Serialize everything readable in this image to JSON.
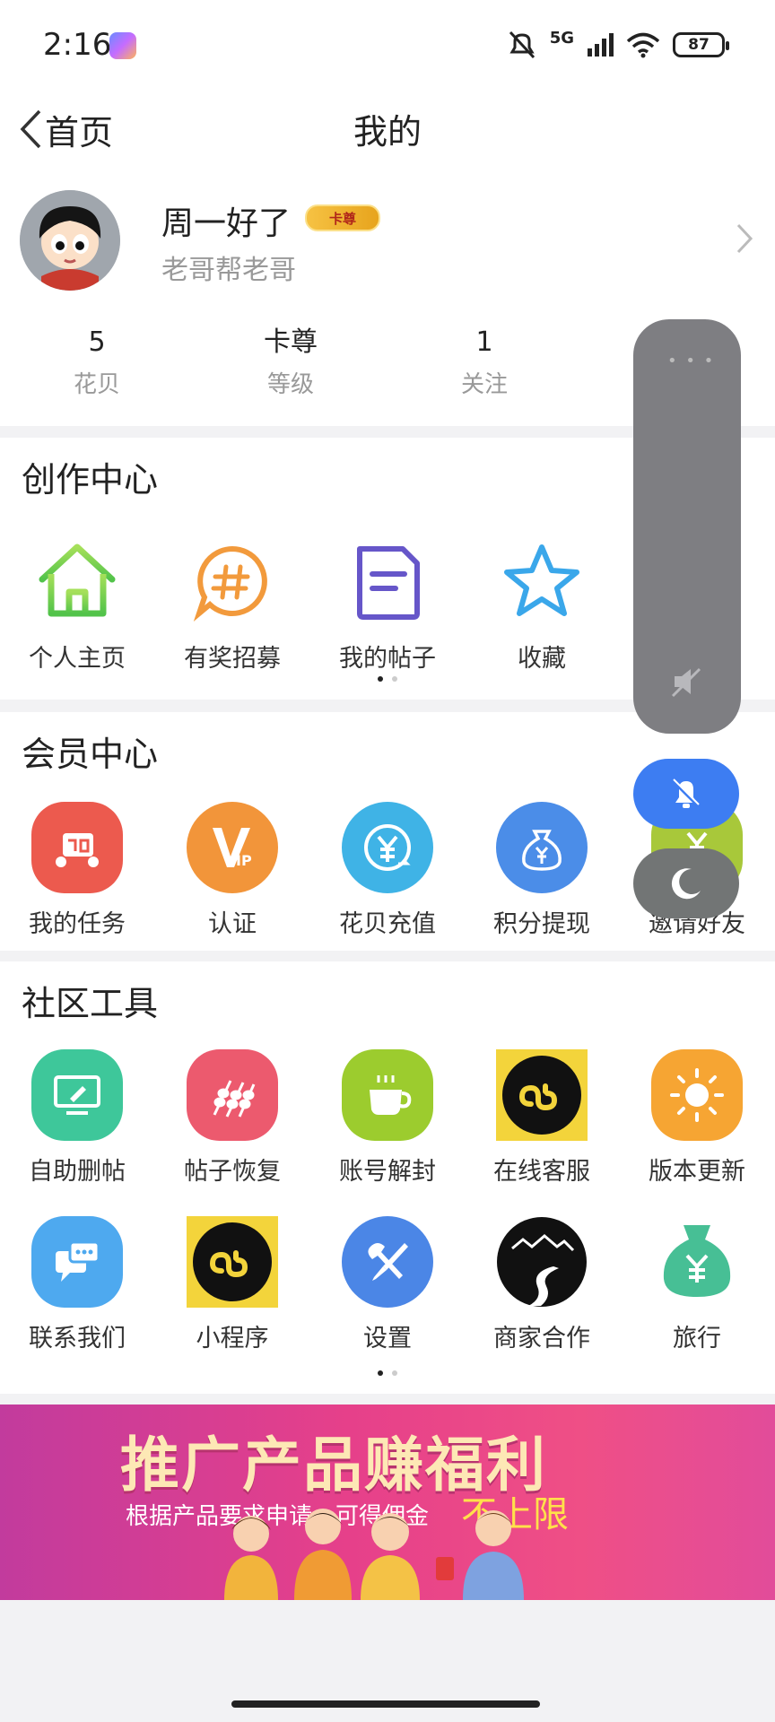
{
  "status_bar": {
    "time": "2:16",
    "network": "5G",
    "battery": "87"
  },
  "header": {
    "back_label": "首页",
    "title": "我的"
  },
  "profile": {
    "nickname": "周一好了",
    "level_badge": "卡尊",
    "signature": "老哥帮老哥",
    "stats": [
      {
        "value": "5",
        "label": "花贝"
      },
      {
        "value": "卡尊",
        "label": "等级"
      },
      {
        "value": "1",
        "label": "关注"
      }
    ]
  },
  "creator_center": {
    "title": "创作中心",
    "items": [
      {
        "label": "个人主页",
        "icon": "home-icon"
      },
      {
        "label": "有奖招募",
        "icon": "hashtag-bubble-icon"
      },
      {
        "label": "我的帖子",
        "icon": "document-icon"
      },
      {
        "label": "收藏",
        "icon": "star-icon"
      }
    ],
    "page_count": 2,
    "active_page": 1
  },
  "member_center": {
    "title": "会员中心",
    "items": [
      {
        "label": "我的任务",
        "icon": "task-icon",
        "color": "#ec5a4e"
      },
      {
        "label": "认证",
        "icon": "vip-icon",
        "color": "#f2953a"
      },
      {
        "label": "花贝充值",
        "icon": "yuan-recharge-icon",
        "color": "#3fb3e6"
      },
      {
        "label": "积分提现",
        "icon": "money-bag-icon",
        "color": "#4b8de8"
      },
      {
        "label": "邀请好友",
        "icon": "invite-icon",
        "color": "#a8c83a"
      }
    ]
  },
  "community_tools": {
    "title": "社区工具",
    "items": [
      {
        "label": "自助删帖",
        "icon": "monitor-edit-icon",
        "color": "#3ec79a"
      },
      {
        "label": "帖子恢复",
        "icon": "skewer-icon",
        "color": "#ec5a6e"
      },
      {
        "label": "账号解封",
        "icon": "coffee-cup-icon",
        "color": "#9ccc2e"
      },
      {
        "label": "在线客服",
        "icon": "mini-program-icon",
        "color": "#f3d43b"
      },
      {
        "label": "版本更新",
        "icon": "sun-icon",
        "color": "#f6a533"
      },
      {
        "label": "联系我们",
        "icon": "chat-icon",
        "color": "#4ea9ef"
      },
      {
        "label": "小程序",
        "icon": "mini-program-icon",
        "color": "#f3d43b"
      },
      {
        "label": "设置",
        "icon": "wrench-screwdriver-icon",
        "color": "#4b86e6"
      },
      {
        "label": "商家合作",
        "icon": "mountain-road-icon",
        "color": "#111111"
      },
      {
        "label": "旅行",
        "icon": "money-bag-icon",
        "color": "#47bf95"
      }
    ],
    "page_count": 2,
    "active_page": 1
  },
  "banner": {
    "title": "推广产品赚福利",
    "subtitle": "根据产品要求申请，可得佣金",
    "highlight": "不上限"
  },
  "floating_panel": {
    "icons": [
      "more-dots-icon",
      "mute-icon",
      "bell-off-icon",
      "moon-icon"
    ],
    "accent": "#3d7df2"
  }
}
